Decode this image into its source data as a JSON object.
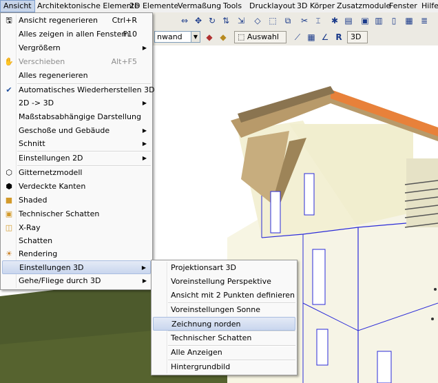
{
  "menubar": {
    "items": [
      "Ansicht",
      "Architektonische Elemente",
      "2D Elemente",
      "Vermaßung",
      "Tools",
      "Drucklayout",
      "3D Körper",
      "Zusatzmodule",
      "Fenster",
      "Hilfe"
    ]
  },
  "toolbar": {
    "combo_value": "nwand",
    "auswahl_label": "Auswahl",
    "r_label": "R",
    "btn3d_label": "3D"
  },
  "menu": {
    "items": [
      {
        "label": "Ansicht regenerieren",
        "shortcut": "Ctrl+R",
        "icon": "regenerate-icon"
      },
      {
        "label": "Alles zeigen in allen Fenstern",
        "shortcut": "F10"
      },
      {
        "label": "Vergrößern",
        "submenu": true
      },
      {
        "label": "Verschieben",
        "shortcut": "Alt+F5",
        "disabled": true,
        "icon": "hand-pan-icon"
      },
      {
        "label": "Alles regenerieren"
      },
      {
        "label": "Automatisches Wiederherstellen 3D",
        "checked": true
      },
      {
        "label": "2D -> 3D",
        "submenu": true
      },
      {
        "label": "Maßstabsabhängige Darstellung"
      },
      {
        "label": "Geschoße und Gebäude",
        "submenu": true
      },
      {
        "label": "Schnitt",
        "submenu": true
      },
      {
        "label": "Einstellungen 2D",
        "submenu": true
      },
      {
        "label": "Gitternetzmodell",
        "icon": "wireframe-cube-icon"
      },
      {
        "label": "Verdeckte Kanten",
        "icon": "hidden-lines-cube-icon"
      },
      {
        "label": "Shaded",
        "icon": "shaded-cube-icon"
      },
      {
        "label": "Technischer Schatten",
        "icon": "technical-shadow-cube-icon"
      },
      {
        "label": "X-Ray",
        "icon": "xray-cube-icon"
      },
      {
        "label": "Schatten"
      },
      {
        "label": "Rendering",
        "icon": "rendering-icon"
      },
      {
        "label": "Einstellungen 3D",
        "submenu": true,
        "highlighted": true
      },
      {
        "label": "Gehe/Fliege durch 3D",
        "submenu": true
      }
    ]
  },
  "submenu": {
    "items": [
      {
        "label": "Projektionsart 3D"
      },
      {
        "label": "Voreinstellung Perspektive"
      },
      {
        "label": "Ansicht mit 2 Punkten definieren"
      },
      {
        "label": "Voreinstellungen Sonne"
      },
      {
        "label": "Zeichnung norden",
        "highlighted": true
      },
      {
        "label": "Technischer Schatten"
      },
      {
        "label": "Alle Anzeigen"
      },
      {
        "label": "Hintergrundbild"
      }
    ]
  },
  "colors": {
    "wall": "#f3f0d4",
    "wall_shadow": "#e4e0bf",
    "roof_wood": "#b89a6a",
    "roof_edge": "#e8813a",
    "ground": "#4d5a2c",
    "wireframe": "#2a2ad8",
    "highlight": "#c9d6ee"
  }
}
